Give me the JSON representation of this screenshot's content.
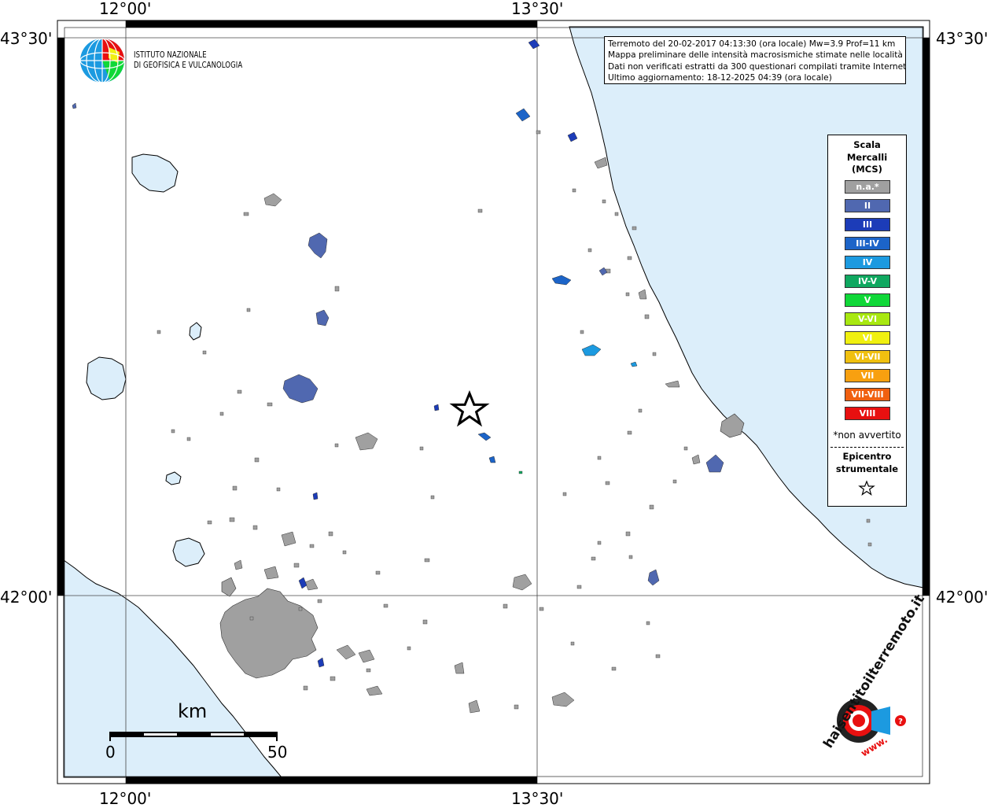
{
  "coords": {
    "top_left_lon": "12°00'",
    "top_right_lon": "13°30'",
    "bottom_left_lon": "12°00'",
    "bottom_right_lon": "13°30'",
    "left_top_lat": "43°30'",
    "left_bottom_lat": "42°00'",
    "right_top_lat": "43°30'",
    "right_bottom_lat": "42°00'"
  },
  "info": {
    "line1": "Terremoto del 20-02-2017 04:13:30 (ora locale) Mw=3.9 Prof=11 km",
    "line2": "Mappa preliminare delle intensità macrosismiche stimate nelle località",
    "line3": "Dati non verificati estratti da 300 questionari compilati tramite Internet.",
    "line4": "Ultimo aggiornamento: 18-12-2025 04:39 (ora locale)"
  },
  "logo": {
    "line1": "ISTITUTO NAZIONALE",
    "line2": "DI GEOFISICA E VULCANOLOGIA"
  },
  "legend": {
    "title_line1": "Scala",
    "title_line2": "Mercalli",
    "title_line3": "(MCS)",
    "items": [
      {
        "label": "n.a.*",
        "color": "#a0a0a0"
      },
      {
        "label": "II",
        "color": "#5068b0"
      },
      {
        "label": "III",
        "color": "#1c3cb8"
      },
      {
        "label": "III-IV",
        "color": "#1c64c8"
      },
      {
        "label": "IV",
        "color": "#1c9ae0"
      },
      {
        "label": "IV-V",
        "color": "#10a860"
      },
      {
        "label": "V",
        "color": "#10d838"
      },
      {
        "label": "V-VI",
        "color": "#a8e810"
      },
      {
        "label": "VI",
        "color": "#f0f010"
      },
      {
        "label": "VI-VII",
        "color": "#f0c010"
      },
      {
        "label": "VII",
        "color": "#f8a010"
      },
      {
        "label": "VII-VIII",
        "color": "#f06010"
      },
      {
        "label": "VIII",
        "color": "#e81010"
      }
    ],
    "note": "*non avvertito",
    "epicenter_line1": "Epicentro",
    "epicenter_line2": "strumentale"
  },
  "scalebar": {
    "unit": "km",
    "min": "0",
    "max": "50"
  },
  "badge": {
    "text": "haisentitoilterremoto.it",
    "url_text": "www."
  },
  "colors": {
    "sea": "#dceefa",
    "towns_na": "#a0a0a0",
    "intensity_II": "#5068b0",
    "intensity_III": "#1c3cb8",
    "intensity_III_IV": "#1c64c8",
    "intensity_IV": "#1c9ae0"
  }
}
